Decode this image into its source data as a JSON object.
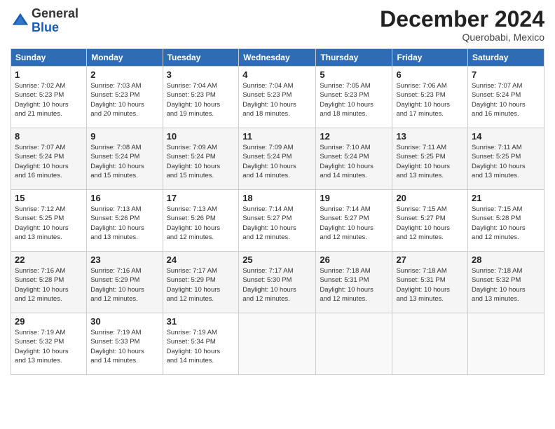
{
  "header": {
    "logo_line1": "General",
    "logo_line2": "Blue",
    "month": "December 2024",
    "location": "Querobabi, Mexico"
  },
  "weekdays": [
    "Sunday",
    "Monday",
    "Tuesday",
    "Wednesday",
    "Thursday",
    "Friday",
    "Saturday"
  ],
  "weeks": [
    [
      {
        "day": "1",
        "info": "Sunrise: 7:02 AM\nSunset: 5:23 PM\nDaylight: 10 hours\nand 21 minutes."
      },
      {
        "day": "2",
        "info": "Sunrise: 7:03 AM\nSunset: 5:23 PM\nDaylight: 10 hours\nand 20 minutes."
      },
      {
        "day": "3",
        "info": "Sunrise: 7:04 AM\nSunset: 5:23 PM\nDaylight: 10 hours\nand 19 minutes."
      },
      {
        "day": "4",
        "info": "Sunrise: 7:04 AM\nSunset: 5:23 PM\nDaylight: 10 hours\nand 18 minutes."
      },
      {
        "day": "5",
        "info": "Sunrise: 7:05 AM\nSunset: 5:23 PM\nDaylight: 10 hours\nand 18 minutes."
      },
      {
        "day": "6",
        "info": "Sunrise: 7:06 AM\nSunset: 5:23 PM\nDaylight: 10 hours\nand 17 minutes."
      },
      {
        "day": "7",
        "info": "Sunrise: 7:07 AM\nSunset: 5:24 PM\nDaylight: 10 hours\nand 16 minutes."
      }
    ],
    [
      {
        "day": "8",
        "info": "Sunrise: 7:07 AM\nSunset: 5:24 PM\nDaylight: 10 hours\nand 16 minutes."
      },
      {
        "day": "9",
        "info": "Sunrise: 7:08 AM\nSunset: 5:24 PM\nDaylight: 10 hours\nand 15 minutes."
      },
      {
        "day": "10",
        "info": "Sunrise: 7:09 AM\nSunset: 5:24 PM\nDaylight: 10 hours\nand 15 minutes."
      },
      {
        "day": "11",
        "info": "Sunrise: 7:09 AM\nSunset: 5:24 PM\nDaylight: 10 hours\nand 14 minutes."
      },
      {
        "day": "12",
        "info": "Sunrise: 7:10 AM\nSunset: 5:24 PM\nDaylight: 10 hours\nand 14 minutes."
      },
      {
        "day": "13",
        "info": "Sunrise: 7:11 AM\nSunset: 5:25 PM\nDaylight: 10 hours\nand 13 minutes."
      },
      {
        "day": "14",
        "info": "Sunrise: 7:11 AM\nSunset: 5:25 PM\nDaylight: 10 hours\nand 13 minutes."
      }
    ],
    [
      {
        "day": "15",
        "info": "Sunrise: 7:12 AM\nSunset: 5:25 PM\nDaylight: 10 hours\nand 13 minutes."
      },
      {
        "day": "16",
        "info": "Sunrise: 7:13 AM\nSunset: 5:26 PM\nDaylight: 10 hours\nand 13 minutes."
      },
      {
        "day": "17",
        "info": "Sunrise: 7:13 AM\nSunset: 5:26 PM\nDaylight: 10 hours\nand 12 minutes."
      },
      {
        "day": "18",
        "info": "Sunrise: 7:14 AM\nSunset: 5:27 PM\nDaylight: 10 hours\nand 12 minutes."
      },
      {
        "day": "19",
        "info": "Sunrise: 7:14 AM\nSunset: 5:27 PM\nDaylight: 10 hours\nand 12 minutes."
      },
      {
        "day": "20",
        "info": "Sunrise: 7:15 AM\nSunset: 5:27 PM\nDaylight: 10 hours\nand 12 minutes."
      },
      {
        "day": "21",
        "info": "Sunrise: 7:15 AM\nSunset: 5:28 PM\nDaylight: 10 hours\nand 12 minutes."
      }
    ],
    [
      {
        "day": "22",
        "info": "Sunrise: 7:16 AM\nSunset: 5:28 PM\nDaylight: 10 hours\nand 12 minutes."
      },
      {
        "day": "23",
        "info": "Sunrise: 7:16 AM\nSunset: 5:29 PM\nDaylight: 10 hours\nand 12 minutes."
      },
      {
        "day": "24",
        "info": "Sunrise: 7:17 AM\nSunset: 5:29 PM\nDaylight: 10 hours\nand 12 minutes."
      },
      {
        "day": "25",
        "info": "Sunrise: 7:17 AM\nSunset: 5:30 PM\nDaylight: 10 hours\nand 12 minutes."
      },
      {
        "day": "26",
        "info": "Sunrise: 7:18 AM\nSunset: 5:31 PM\nDaylight: 10 hours\nand 12 minutes."
      },
      {
        "day": "27",
        "info": "Sunrise: 7:18 AM\nSunset: 5:31 PM\nDaylight: 10 hours\nand 13 minutes."
      },
      {
        "day": "28",
        "info": "Sunrise: 7:18 AM\nSunset: 5:32 PM\nDaylight: 10 hours\nand 13 minutes."
      }
    ],
    [
      {
        "day": "29",
        "info": "Sunrise: 7:19 AM\nSunset: 5:32 PM\nDaylight: 10 hours\nand 13 minutes."
      },
      {
        "day": "30",
        "info": "Sunrise: 7:19 AM\nSunset: 5:33 PM\nDaylight: 10 hours\nand 14 minutes."
      },
      {
        "day": "31",
        "info": "Sunrise: 7:19 AM\nSunset: 5:34 PM\nDaylight: 10 hours\nand 14 minutes."
      },
      {
        "day": "",
        "info": ""
      },
      {
        "day": "",
        "info": ""
      },
      {
        "day": "",
        "info": ""
      },
      {
        "day": "",
        "info": ""
      }
    ]
  ]
}
